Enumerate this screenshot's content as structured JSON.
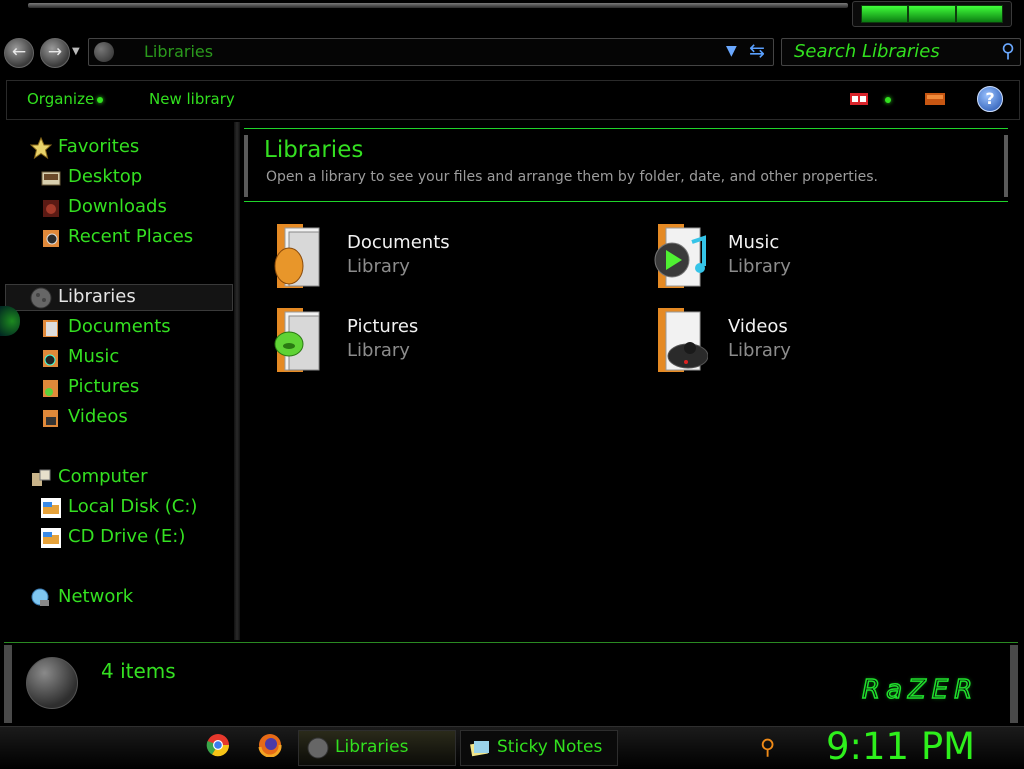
{
  "window": {
    "title": "Libraries"
  },
  "nav": {
    "back_icon": "back-arrow-icon",
    "forward_icon": "forward-arrow-icon"
  },
  "address_bar": {
    "path": "Libraries"
  },
  "search": {
    "placeholder": "Search Libraries"
  },
  "toolbar": {
    "organize": "Organize",
    "new_library": "New library"
  },
  "sidebar": {
    "favorites": {
      "label": "Favorites",
      "items": [
        "Desktop",
        "Downloads",
        "Recent Places"
      ]
    },
    "libraries": {
      "label": "Libraries",
      "items": [
        "Documents",
        "Music",
        "Pictures",
        "Videos"
      ]
    },
    "computer": {
      "label": "Computer",
      "items": [
        "Local Disk (C:)",
        "CD Drive (E:)"
      ]
    },
    "network": {
      "label": "Network"
    }
  },
  "header": {
    "title": "Libraries",
    "subtitle": "Open a library to see your files and arrange them by folder, date, and other properties."
  },
  "libraries": [
    {
      "name": "Documents",
      "type": "Library"
    },
    {
      "name": "Music",
      "type": "Library"
    },
    {
      "name": "Pictures",
      "type": "Library"
    },
    {
      "name": "Videos",
      "type": "Library"
    }
  ],
  "status": {
    "count": "4 items",
    "brand": "RaZER"
  },
  "taskbar": {
    "apps": [
      "Libraries",
      "Sticky Notes"
    ],
    "clock": "9:11 PM"
  },
  "colors": {
    "accent": "#34e021",
    "background": "#000000",
    "muted": "#8c8c8c"
  }
}
